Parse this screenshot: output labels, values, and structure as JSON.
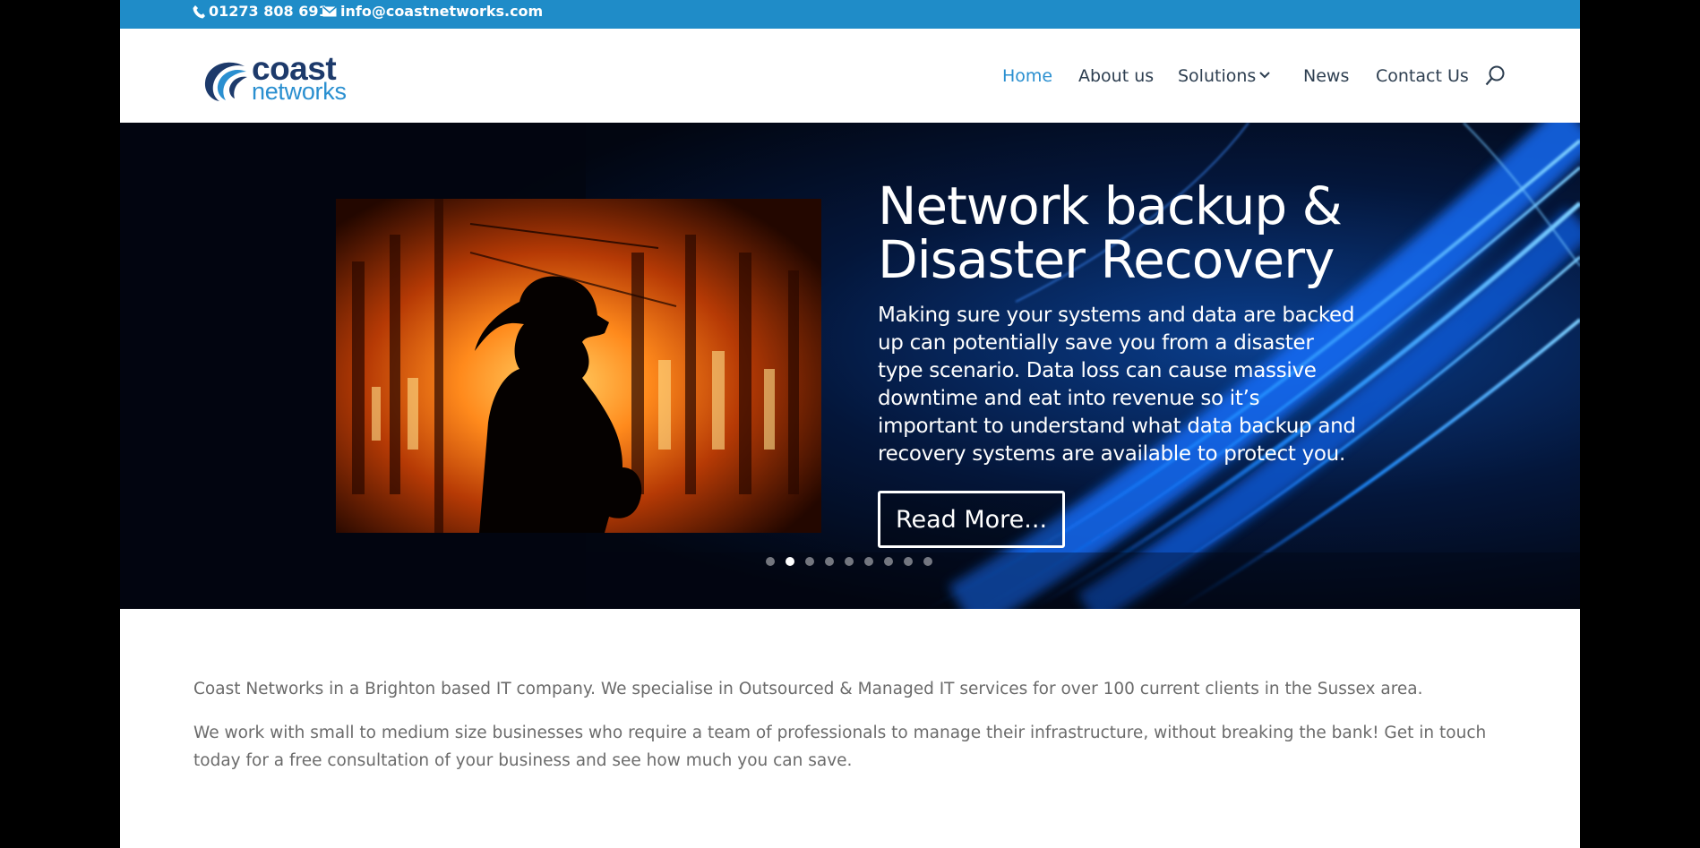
{
  "topbar": {
    "phone": "01273 808 691",
    "email": "info@coastnetworks.com",
    "phone_icon": "phone-icon",
    "email_icon": "envelope-icon",
    "background": "#1f8cc8"
  },
  "logo": {
    "word1": "coast",
    "word2": "networks",
    "brand_dark": "#1d3a6b",
    "brand_light": "#2a8fd0"
  },
  "nav": {
    "items": [
      {
        "label": "Home",
        "active": true
      },
      {
        "label": "About us",
        "active": false
      },
      {
        "label": "Solutions",
        "active": false,
        "has_dropdown": true
      },
      {
        "label": "News",
        "active": false
      },
      {
        "label": "Contact Us",
        "active": false
      }
    ],
    "search_icon": "search-icon"
  },
  "slider": {
    "title_line1": "Network backup &",
    "title_line2": "Disaster Recovery",
    "description": "Making sure your systems and data are backed up can potentially save you from a disaster type scenario. Data loss can cause massive downtime and eat into revenue so it’s important to understand what data backup and recovery systems are available to protect you.",
    "button_label": "Read More...",
    "slide_count": 9,
    "active_slide": 2
  },
  "content": {
    "paragraph1": "Coast Networks in a Brighton based IT company. We specialise in Outsourced & Managed IT services for over 100 current clients in the Sussex area.",
    "paragraph2": "We work with small to medium size businesses who require a team of professionals to manage their infrastructure, without breaking the bank! Get in touch today for a free consultation of your business and see how much you can save."
  }
}
